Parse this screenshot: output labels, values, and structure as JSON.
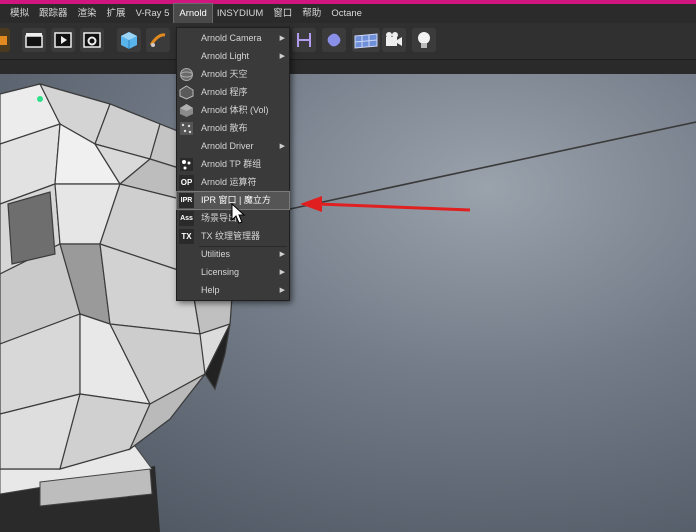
{
  "menubar": {
    "items": [
      {
        "label": "模拟"
      },
      {
        "label": "跟踪器"
      },
      {
        "label": "渲染"
      },
      {
        "label": "扩展"
      },
      {
        "label": "V-Ray 5"
      },
      {
        "label": "Arnold"
      },
      {
        "label": "INSYDIUM"
      },
      {
        "label": "窗口"
      },
      {
        "label": "帮助"
      },
      {
        "label": "Octane"
      }
    ],
    "active": "Arnold"
  },
  "arnold_menu": {
    "items": [
      {
        "label": "Arnold Camera",
        "submenu": true,
        "icon": "none"
      },
      {
        "label": "Arnold Light",
        "submenu": true,
        "icon": "none"
      },
      {
        "label": "Arnold 天空",
        "submenu": false,
        "icon": "sky-sphere-icon"
      },
      {
        "label": "Arnold 程序",
        "submenu": false,
        "icon": "procedural-icon"
      },
      {
        "label": "Arnold 体积 (Vol)",
        "submenu": false,
        "icon": "volume-icon"
      },
      {
        "label": "Arnold 散布",
        "submenu": false,
        "icon": "scatter-icon"
      },
      {
        "label": "Arnold Driver",
        "submenu": true,
        "icon": "none"
      },
      {
        "label": "Arnold TP 群组",
        "submenu": false,
        "icon": "tp-group-icon"
      },
      {
        "label": "Arnold 运算符",
        "submenu": false,
        "icon_text": "OP"
      },
      {
        "label": "IPR 窗口 | 魔立方",
        "submenu": false,
        "icon_text": "IPR",
        "highlighted": true
      },
      {
        "label": "场景导出",
        "submenu": false,
        "icon_text": "Ass"
      },
      {
        "label": "TX 纹理管理器",
        "submenu": false,
        "icon_text": "TX"
      },
      {
        "label": "Utilities",
        "submenu": true,
        "icon": "none"
      },
      {
        "label": "Licensing",
        "submenu": true,
        "icon": "none"
      },
      {
        "label": "Help",
        "submenu": true,
        "icon": "none"
      }
    ]
  },
  "colors": {
    "accent_bar": "#d0167e",
    "annotation_arrow": "#e02020",
    "menu_bg": "#3a3a3a",
    "menubar_bg": "#2b2b2b"
  },
  "toolbar": {
    "left_icons": [
      "render-region-icon",
      "clapper-icon",
      "render-view-icon",
      "render-settings-icon",
      "cube-icon",
      "pen-icon"
    ],
    "right_icons": [
      "bracket-icon",
      "capsule-icon",
      "grid-plane-icon",
      "camera-icon",
      "light-bulb-icon"
    ]
  }
}
